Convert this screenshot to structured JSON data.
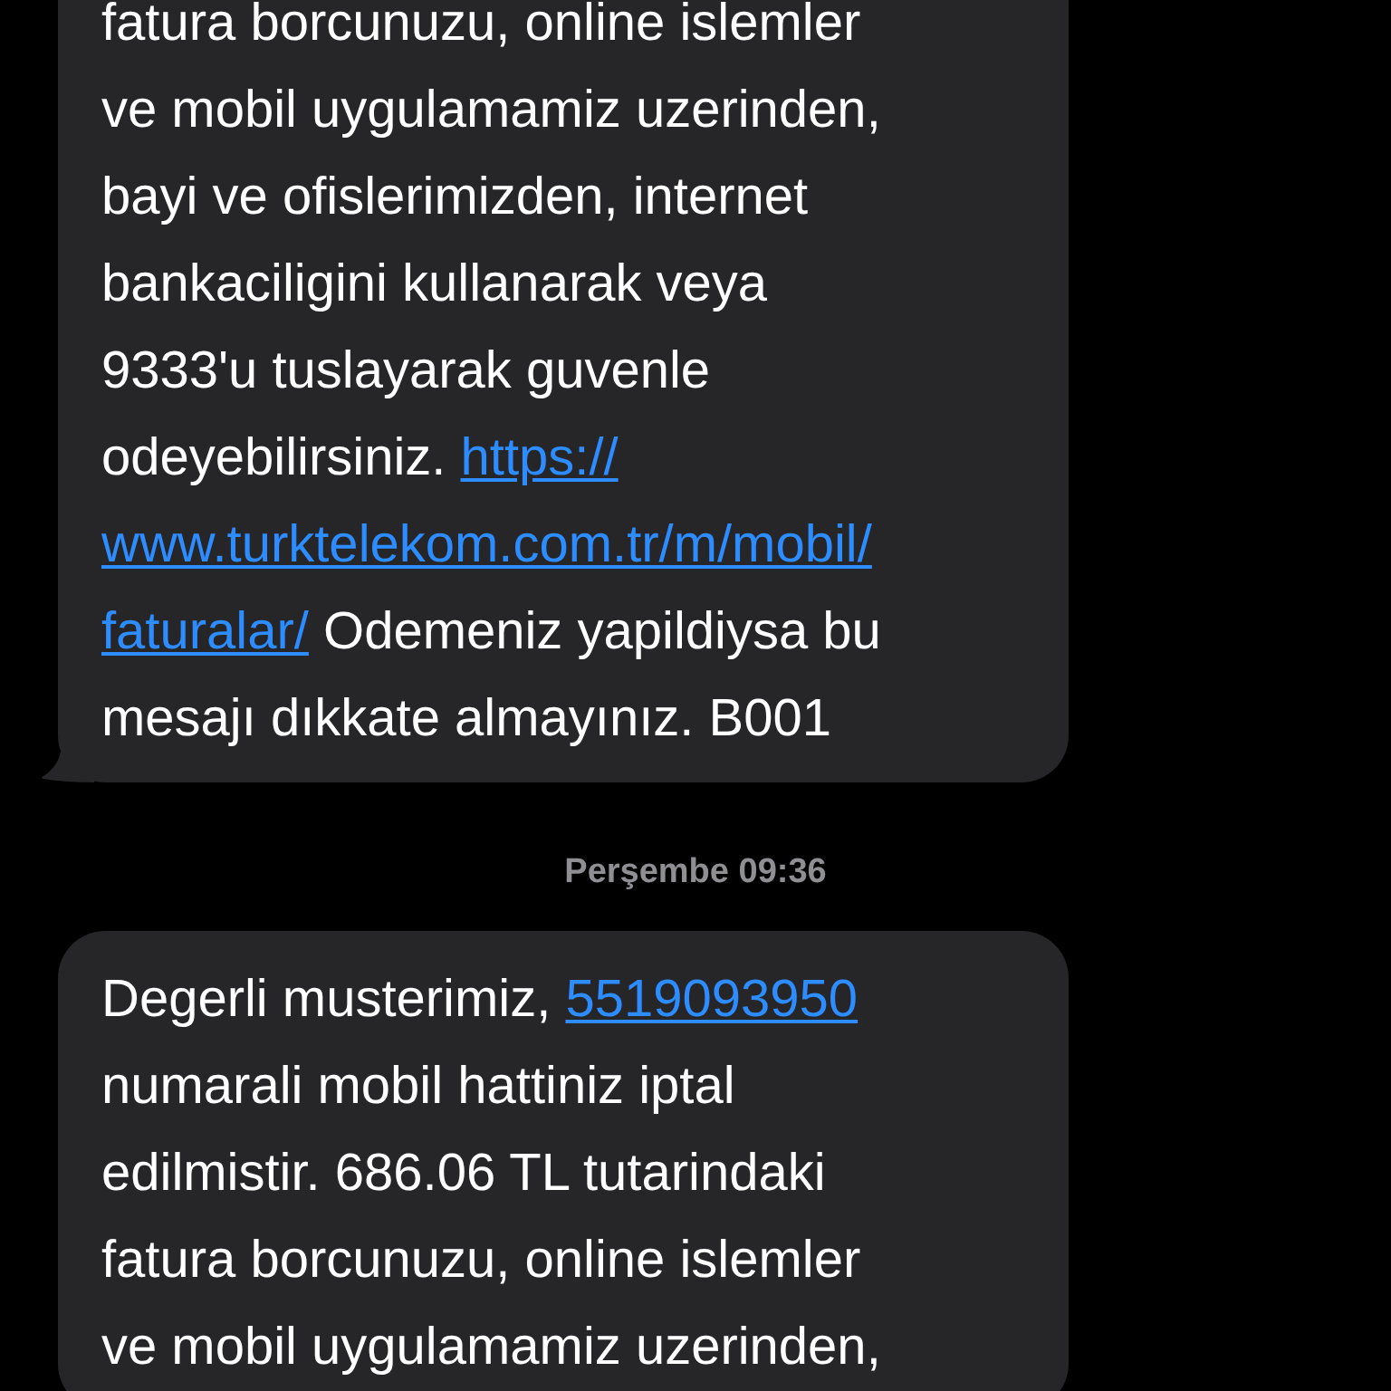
{
  "messages": [
    {
      "lines": [
        [
          {
            "kind": "text",
            "text": "fatura borcunuzu, online islemler"
          }
        ],
        [
          {
            "kind": "text",
            "text": "ve mobil uygulamamiz uzerinden,"
          }
        ],
        [
          {
            "kind": "text",
            "text": "bayi ve ofislerimizden, internet"
          }
        ],
        [
          {
            "kind": "text",
            "text": "bankaciligini kullanarak veya"
          }
        ],
        [
          {
            "kind": "text",
            "text": "9333'u tuslayarak guvenle"
          }
        ],
        [
          {
            "kind": "text",
            "text": "odeyebilirsiniz. "
          },
          {
            "kind": "link",
            "text": "https://"
          }
        ],
        [
          {
            "kind": "link",
            "text": "www.turktelekom.com.tr/m/mobil/"
          }
        ],
        [
          {
            "kind": "link",
            "text": "faturalar/"
          },
          {
            "kind": "text",
            "text": " Odemeniz yapildiysa bu"
          }
        ],
        [
          {
            "kind": "text",
            "text": "mesajı dıkkate almayınız. B001"
          }
        ]
      ],
      "tail": true
    },
    {
      "timestamp": "Perşembe 09:36"
    },
    {
      "lines": [
        [
          {
            "kind": "text",
            "text": "Degerli musterimiz, "
          },
          {
            "kind": "link",
            "text": "5519093950"
          }
        ],
        [
          {
            "kind": "text",
            "text": "numarali mobil hattiniz iptal"
          }
        ],
        [
          {
            "kind": "text",
            "text": "edilmistir. 686.06 TL tutarindaki"
          }
        ],
        [
          {
            "kind": "text",
            "text": "fatura borcunuzu, online islemler"
          }
        ],
        [
          {
            "kind": "text",
            "text": "ve mobil uygulamamiz uzerinden,"
          }
        ]
      ],
      "tail": false
    }
  ]
}
